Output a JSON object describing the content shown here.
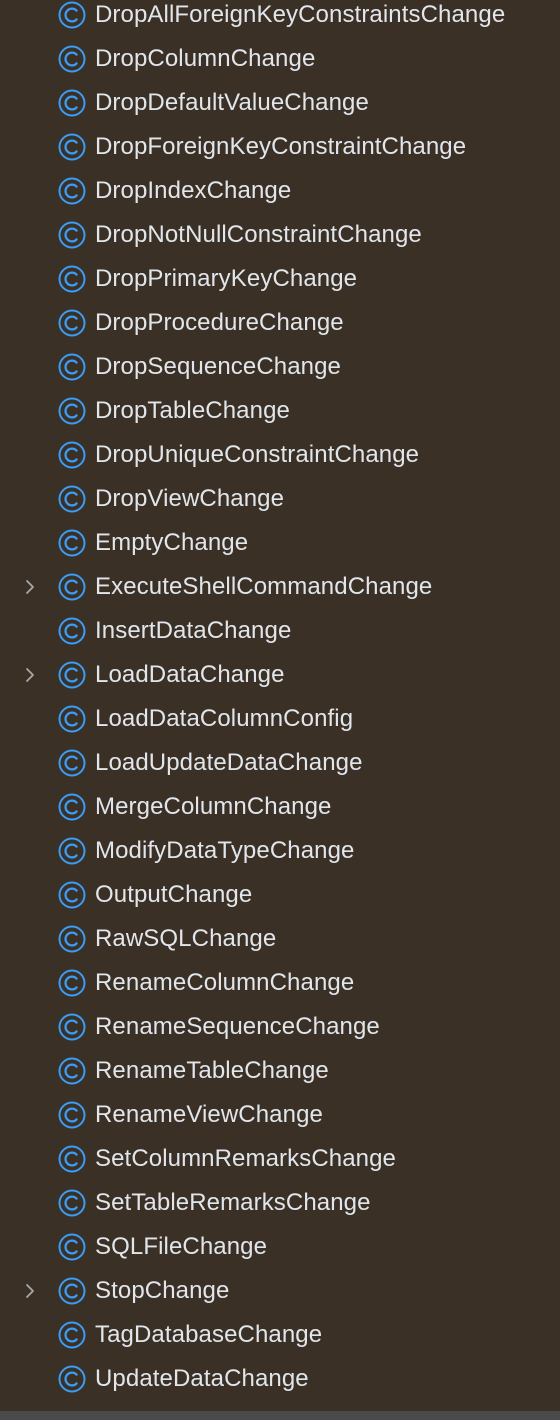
{
  "tree": {
    "items": [
      {
        "label": "DropAllForeignKeyConstraintsChange",
        "expandable": false
      },
      {
        "label": "DropColumnChange",
        "expandable": false
      },
      {
        "label": "DropDefaultValueChange",
        "expandable": false
      },
      {
        "label": "DropForeignKeyConstraintChange",
        "expandable": false
      },
      {
        "label": "DropIndexChange",
        "expandable": false
      },
      {
        "label": "DropNotNullConstraintChange",
        "expandable": false
      },
      {
        "label": "DropPrimaryKeyChange",
        "expandable": false
      },
      {
        "label": "DropProcedureChange",
        "expandable": false
      },
      {
        "label": "DropSequenceChange",
        "expandable": false
      },
      {
        "label": "DropTableChange",
        "expandable": false
      },
      {
        "label": "DropUniqueConstraintChange",
        "expandable": false
      },
      {
        "label": "DropViewChange",
        "expandable": false
      },
      {
        "label": "EmptyChange",
        "expandable": false
      },
      {
        "label": "ExecuteShellCommandChange",
        "expandable": true
      },
      {
        "label": "InsertDataChange",
        "expandable": false
      },
      {
        "label": "LoadDataChange",
        "expandable": true
      },
      {
        "label": "LoadDataColumnConfig",
        "expandable": false
      },
      {
        "label": "LoadUpdateDataChange",
        "expandable": false
      },
      {
        "label": "MergeColumnChange",
        "expandable": false
      },
      {
        "label": "ModifyDataTypeChange",
        "expandable": false
      },
      {
        "label": "OutputChange",
        "expandable": false
      },
      {
        "label": "RawSQLChange",
        "expandable": false
      },
      {
        "label": "RenameColumnChange",
        "expandable": false
      },
      {
        "label": "RenameSequenceChange",
        "expandable": false
      },
      {
        "label": "RenameTableChange",
        "expandable": false
      },
      {
        "label": "RenameViewChange",
        "expandable": false
      },
      {
        "label": "SetColumnRemarksChange",
        "expandable": false
      },
      {
        "label": "SetTableRemarksChange",
        "expandable": false
      },
      {
        "label": "SQLFileChange",
        "expandable": false
      },
      {
        "label": "StopChange",
        "expandable": true
      },
      {
        "label": "TagDatabaseChange",
        "expandable": false
      },
      {
        "label": "UpdateDataChange",
        "expandable": false
      }
    ],
    "icon": "class-c-icon",
    "expand_icon": "chevron-right-icon"
  },
  "colors": {
    "background": "#3b3025",
    "label": "#e1e6ec",
    "class_icon": "#3b9cf5",
    "chevron": "#a8a8a8",
    "bottom_bar": "#4a4a4c"
  }
}
